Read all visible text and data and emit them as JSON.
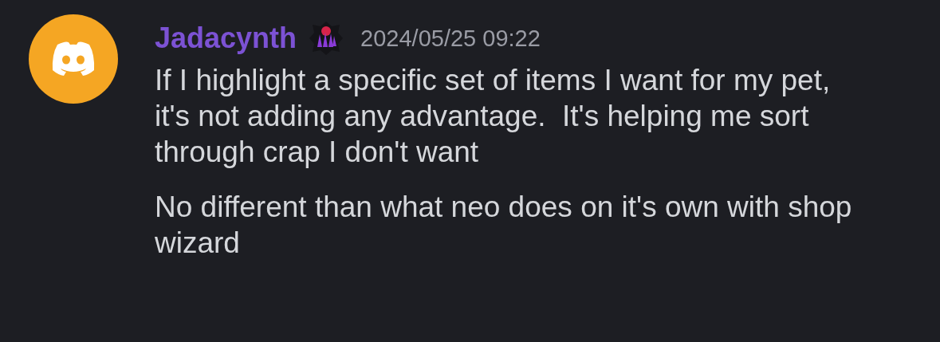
{
  "message_group": {
    "author": {
      "name": "Jadacynth"
    },
    "timestamp": "2024/05/25 09:22",
    "messages": [
      {
        "text": "If I highlight a specific set of items I want for my pet,  it's not adding any advantage.  It's helping me sort through crap I don't want"
      },
      {
        "text": "No different than what neo does on it's own with shop wizard"
      }
    ]
  }
}
